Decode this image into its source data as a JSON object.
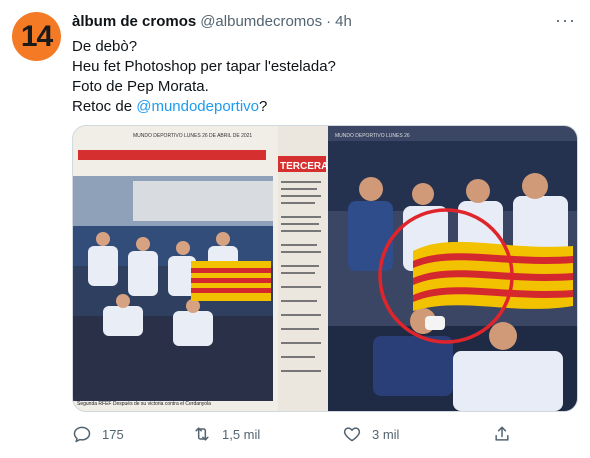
{
  "tweet": {
    "avatar_text": "14",
    "display_name": "àlbum de cromos",
    "handle": "@albumdecromos",
    "separator": "·",
    "time": "4h",
    "more_label": "···",
    "lines": [
      "De debò?",
      "Heu fet Photoshop per tapar l'estelada?",
      "Foto de Pep Morata."
    ],
    "last_line_prefix": "Retoc de ",
    "mention": "@mundodeportivo",
    "last_line_suffix": "?"
  },
  "media": {
    "newspaper_header": "MUNDO DEPORTIVO LUNES 26 DE ABRIL DE 2021",
    "newspaper_section": "TERCERA",
    "newspaper_caption": "Segunda RFEF Después de su victoria contra el Cerdanyola",
    "right_header": "MUNDO DEPORTIVO LUNES 26"
  },
  "actions": {
    "replies": "175",
    "retweets": "1,5 mil",
    "likes": "3 mil"
  },
  "colors": {
    "accent": "#1d9bf0",
    "avatar_bg": "#f47a26",
    "circle": "#e0242b"
  }
}
